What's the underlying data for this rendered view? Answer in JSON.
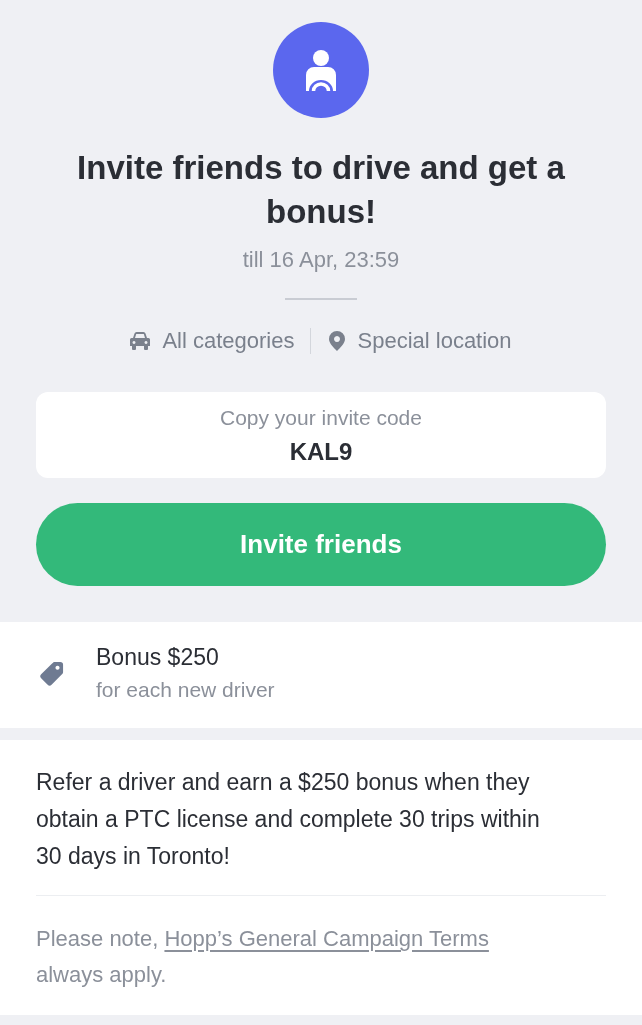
{
  "header": {
    "title": "Invite friends to drive and get a bonus!",
    "deadline": "till 16 Apr, 23:59",
    "tags": [
      {
        "kind": "category",
        "label": "All categories"
      },
      {
        "kind": "location",
        "label": "Special location"
      }
    ]
  },
  "invite_code": {
    "label": "Copy your invite code",
    "code": "KAL9"
  },
  "primary_button": {
    "label": "Invite friends"
  },
  "bonus": {
    "title": "Bonus $250",
    "subtitle": "for each new driver"
  },
  "details": {
    "text": "Refer a driver and earn a $250 bonus when they obtain a PTC license and complete 30 trips within 30 days in Toronto!",
    "note": {
      "prefix": "Please note,",
      "link": "Hopp’s General Campaign Terms",
      "suffix": "always apply."
    }
  }
}
